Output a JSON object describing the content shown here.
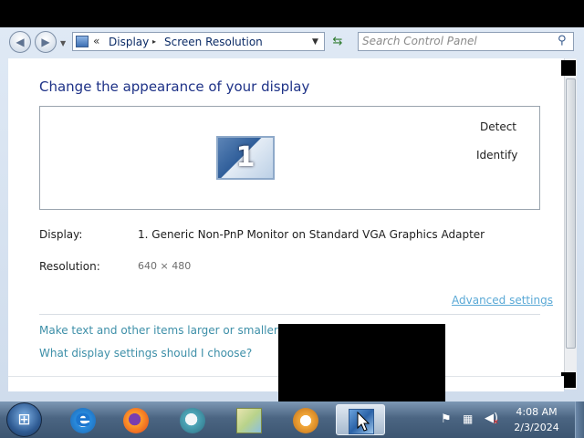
{
  "address_bar": {
    "chevron": "«",
    "breadcrumbs": [
      "Display",
      "Screen Resolution"
    ],
    "separator": "▸"
  },
  "search": {
    "placeholder": "Search Control Panel"
  },
  "page": {
    "title": "Change the appearance of your display",
    "detect_label": "Detect",
    "identify_label": "Identify",
    "monitor_number": "1",
    "display_label": "Display:",
    "display_value": "1. Generic Non-PnP Monitor on Standard VGA Graphics Adapter",
    "resolution_label": "Resolution:",
    "resolution_value": "640 × 480",
    "advanced_settings": "Advanced settings",
    "link_text_size": "Make text and other items larger or smaller",
    "link_help": "What display settings should I choose?"
  },
  "taskbar": {
    "icons": [
      "start-orb",
      "internet-explorer",
      "firefox",
      "browser",
      "paint",
      "media-player",
      "control-panel"
    ],
    "clock_time": "4:08 AM",
    "clock_date": "2/3/2024"
  },
  "colors": {
    "title": "#1e3287",
    "link": "#3d8fa8",
    "advanced_link": "#5aa9d6",
    "taskbar": "#4b6582"
  }
}
